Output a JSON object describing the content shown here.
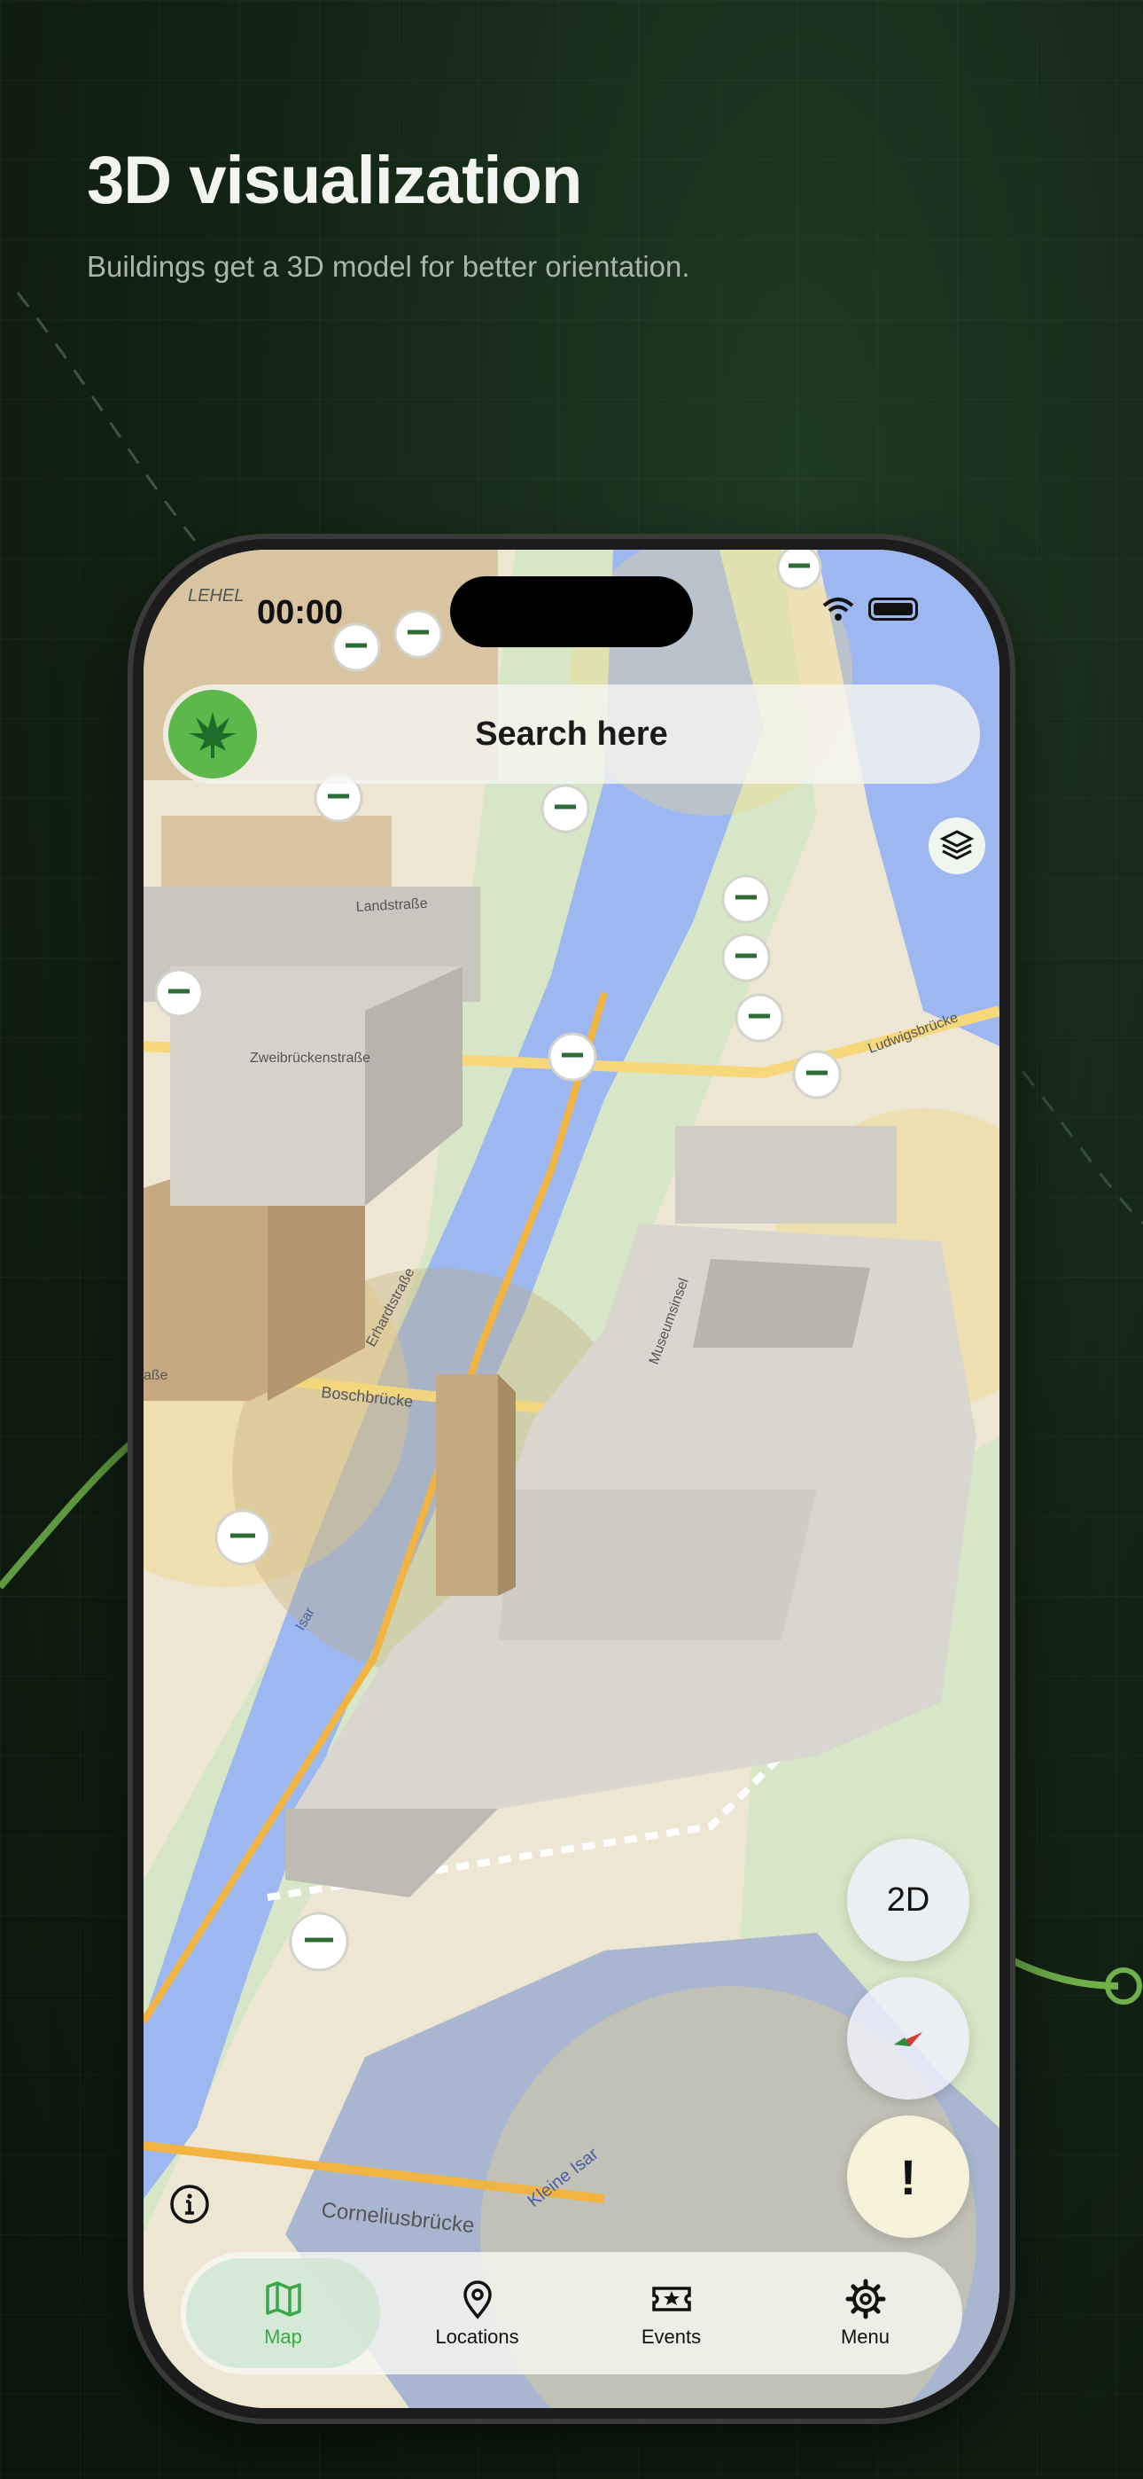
{
  "hero": {
    "title": "3D visualization",
    "subtitle": "Buildings get a 3D model for better orientation."
  },
  "status_bar": {
    "time": "00:00"
  },
  "search": {
    "placeholder": "Search here"
  },
  "map": {
    "labels": {
      "lehel": "LEHEL",
      "landstrasse": "Landstraße",
      "zweibrucken": "Zweibrückenstraße",
      "erhardt": "Erhardtstraße",
      "boschbrucke": "Boschbrücke",
      "museumsinsel": "Museumsinsel",
      "ludwigsbrucke": "Ludwigsbrücke",
      "isar": "Isar",
      "corneliusbrucke": "Corneliusbrücke",
      "kleine_isar": "Kleine Isar",
      "strasse_partial": "aße"
    },
    "colors": {
      "water": "#9db8f0",
      "land": "#ede6d2",
      "park": "#d7e6c7",
      "building": "#d9d6cf",
      "restricted_zone": "#f0d88a",
      "brand_green": "#3da64a"
    }
  },
  "controls": {
    "view_toggle": "2D",
    "alert": "!",
    "layers_icon": "layers-icon",
    "compass_icon": "compass-icon",
    "info_icon": "info-icon"
  },
  "tabs": [
    {
      "label": "Map",
      "icon": "map-icon",
      "active": true
    },
    {
      "label": "Locations",
      "icon": "location-pin-icon",
      "active": false
    },
    {
      "label": "Events",
      "icon": "ticket-icon",
      "active": false
    },
    {
      "label": "Menu",
      "icon": "gear-icon",
      "active": false
    }
  ]
}
